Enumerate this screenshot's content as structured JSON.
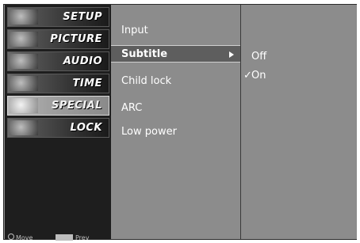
{
  "categories": [
    {
      "label": "SETUP"
    },
    {
      "label": "PICTURE"
    },
    {
      "label": "AUDIO"
    },
    {
      "label": "TIME"
    },
    {
      "label": "SPECIAL",
      "selected": true
    },
    {
      "label": "LOCK"
    }
  ],
  "hints": {
    "move": "Move",
    "prev": "Prev"
  },
  "options": [
    {
      "label": "Input"
    },
    {
      "label": "Subtitle",
      "selected": true
    },
    {
      "label": "Child lock"
    },
    {
      "label": "ARC"
    },
    {
      "label": "Low power"
    }
  ],
  "sub_options": [
    {
      "label": "Off",
      "checked": false
    },
    {
      "label": "On",
      "checked": true
    }
  ],
  "check_mark": "✓"
}
